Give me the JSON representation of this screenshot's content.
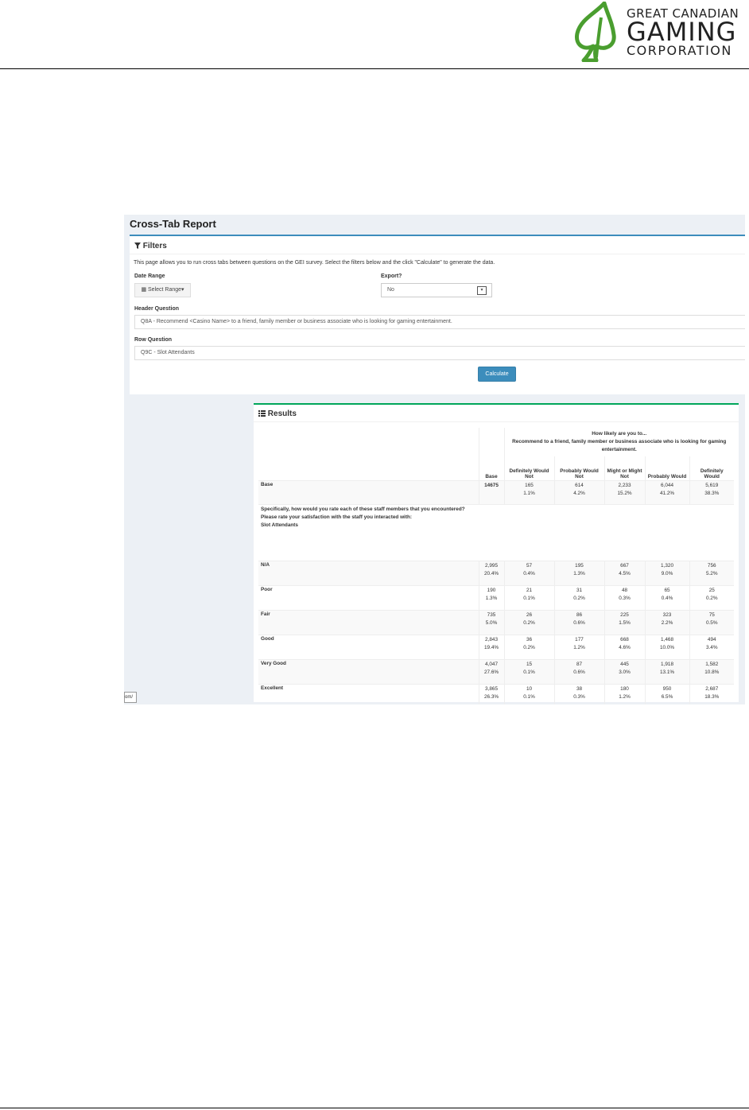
{
  "logo": {
    "line1": "GREAT CANADIAN",
    "line2": "GAMING",
    "line3": "CORPORATION"
  },
  "page_title": "Cross-Tab Report",
  "filters": {
    "title": "Filters",
    "intro": "This page allows you to run cross tabs between questions on the GEI survey. Select the filters below and the click \"Calculate\" to generate the data.",
    "date_range_label": "Date Range",
    "date_range_button": "Select Range",
    "export_label": "Export?",
    "export_value": "No",
    "header_question_label": "Header Question",
    "header_question_value": "Q8A - Recommend <Casino Name> to a friend, family member or business associate who is looking for gaming entertainment.",
    "row_question_label": "Row Question",
    "row_question_value": "Q9C - Slot Attendants",
    "calculate_label": "Calculate"
  },
  "results": {
    "title": "Results",
    "header_question": "How likely are you to...",
    "header_text": "Recommend to a friend, family member or business associate who is looking for gaming entertainment.",
    "base_col": "Base",
    "columns": [
      "Definitely Would Not",
      "Probably Would Not",
      "Might or Might Not",
      "Probably Would",
      "Definitely Would"
    ],
    "base_row": {
      "label": "Base",
      "total": "14675",
      "counts": [
        "165",
        "614",
        "2,233",
        "6,044",
        "5,619"
      ],
      "pcts": [
        "1.1%",
        "4.2%",
        "15.2%",
        "41.2%",
        "38.3%"
      ]
    },
    "row_question": "Specifically, how would you rate each of these staff members that you encountered? Please rate your satisfaction with the staff you interacted with:",
    "row_item": "Slot Attendants",
    "rows": [
      {
        "label": "N/A",
        "base": "2,995",
        "base_pct": "20.4%",
        "counts": [
          "57",
          "195",
          "667",
          "1,320",
          "756"
        ],
        "pcts": [
          "0.4%",
          "1.3%",
          "4.5%",
          "9.0%",
          "5.2%"
        ]
      },
      {
        "label": "Poor",
        "base": "190",
        "base_pct": "1.3%",
        "counts": [
          "21",
          "31",
          "48",
          "65",
          "25"
        ],
        "pcts": [
          "0.1%",
          "0.2%",
          "0.3%",
          "0.4%",
          "0.2%"
        ]
      },
      {
        "label": "Fair",
        "base": "735",
        "base_pct": "5.0%",
        "counts": [
          "26",
          "86",
          "225",
          "323",
          "75"
        ],
        "pcts": [
          "0.2%",
          "0.6%",
          "1.5%",
          "2.2%",
          "0.5%"
        ]
      },
      {
        "label": "Good",
        "base": "2,843",
        "base_pct": "19.4%",
        "counts": [
          "36",
          "177",
          "668",
          "1,468",
          "494"
        ],
        "pcts": [
          "0.2%",
          "1.2%",
          "4.6%",
          "10.0%",
          "3.4%"
        ]
      },
      {
        "label": "Very Good",
        "base": "4,047",
        "base_pct": "27.6%",
        "counts": [
          "15",
          "87",
          "445",
          "1,918",
          "1,582"
        ],
        "pcts": [
          "0.1%",
          "0.6%",
          "3.0%",
          "13.1%",
          "10.8%"
        ]
      },
      {
        "label": "Excellent",
        "base": "3,865",
        "base_pct": "26.3%",
        "counts": [
          "10",
          "38",
          "180",
          "950",
          "2,687"
        ],
        "pcts": [
          "0.1%",
          "0.3%",
          "1.2%",
          "6.5%",
          "18.3%"
        ]
      }
    ]
  },
  "tab_fragment": "om/",
  "colors": {
    "primary": "#3c8dbc",
    "success": "#00a65a",
    "background": "#ecf0f5",
    "logo_green": "#4a9e2f"
  }
}
